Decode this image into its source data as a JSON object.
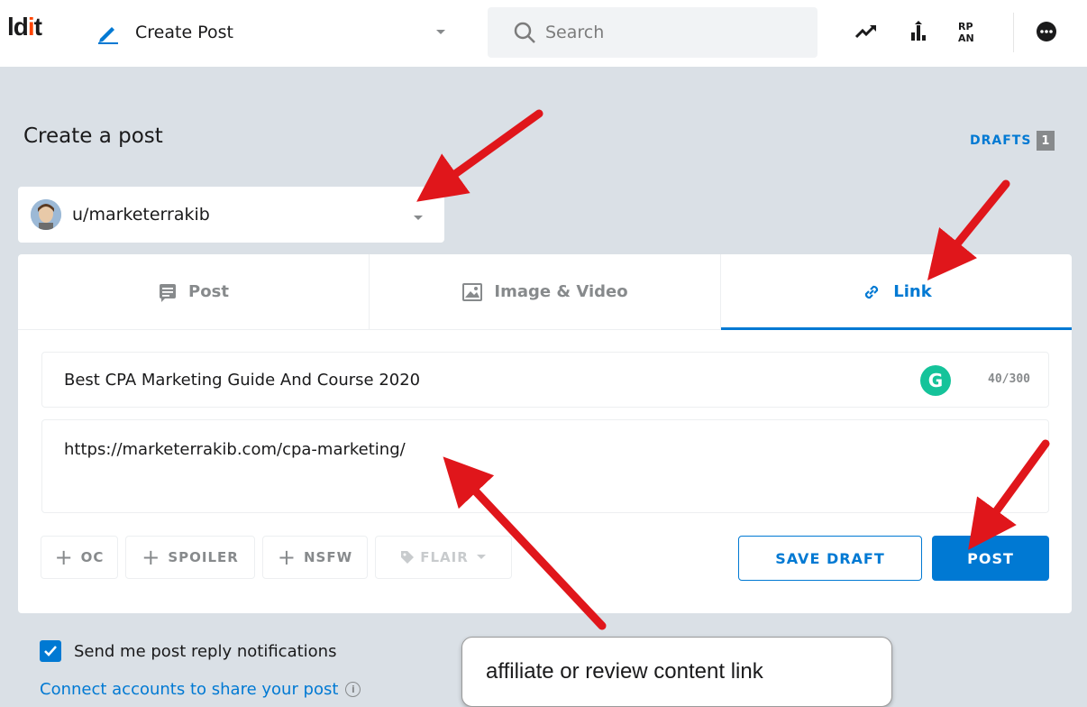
{
  "header": {
    "logo_text": "ldit",
    "nav_label": "Create Post",
    "search_placeholder": "Search",
    "icons": [
      "trending-icon",
      "popular-icon",
      "rpan-icon",
      "chat-icon"
    ],
    "rpan_label": "RP\nAN"
  },
  "page": {
    "title": "Create a post",
    "drafts_label": "DRAFTS",
    "drafts_count": "1"
  },
  "community": {
    "selected": "u/marketerrakib"
  },
  "tabs": [
    {
      "label": "Post",
      "active": false
    },
    {
      "label": "Image & Video",
      "active": false
    },
    {
      "label": "Link",
      "active": true
    }
  ],
  "form": {
    "title_value": "Best CPA Marketing Guide And Course 2020",
    "title_counter": "40/300",
    "url_value": "https://marketerrakib.com/cpa-marketing/"
  },
  "tags": {
    "oc": "OC",
    "spoiler": "SPOILER",
    "nsfw": "NSFW",
    "flair": "FLAIR"
  },
  "actions": {
    "save_draft": "SAVE DRAFT",
    "post": "POST"
  },
  "footer": {
    "notify_label": "Send me post reply notifications",
    "notify_checked": true,
    "connect_label": "Connect accounts to share your post"
  },
  "annotation": {
    "callout_text": "affiliate or review content link",
    "arrow_color": "#e0161b"
  },
  "colors": {
    "accent": "#0079d3",
    "background": "#dae0e6",
    "grammarly": "#15c39a"
  }
}
